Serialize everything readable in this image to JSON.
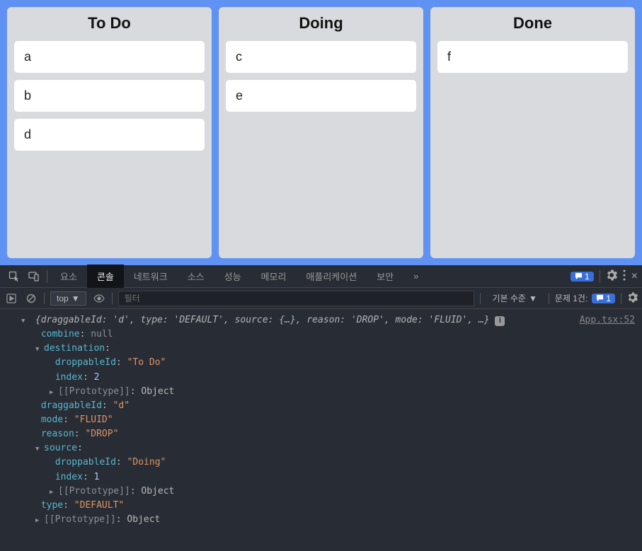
{
  "kanban": {
    "columns": [
      {
        "title": "To Do",
        "cards": [
          "a",
          "b",
          "d"
        ]
      },
      {
        "title": "Doing",
        "cards": [
          "c",
          "e"
        ]
      },
      {
        "title": "Done",
        "cards": [
          "f"
        ]
      }
    ]
  },
  "devtools": {
    "tabs": [
      "요소",
      "콘솔",
      "네트워크",
      "소스",
      "성능",
      "메모리",
      "애플리케이션",
      "보안"
    ],
    "active_tab": "콘솔",
    "more_symbol": "»",
    "badge_count": "1",
    "filter": {
      "top_label": "top",
      "placeholder": "필터",
      "level_label": "기본 수준",
      "issue_label": "문제 1건:",
      "issue_count": "1"
    },
    "console": {
      "source_link": "App.tsx:52",
      "summary_prefix": "{",
      "summary_items": "draggableId: 'd', type: 'DEFAULT', source: {…}, reason: 'DROP', mode: 'FLUID', …}",
      "lines": {
        "combine_key": "combine",
        "combine_val": "null",
        "destination_key": "destination",
        "dest_droppable_key": "droppableId",
        "dest_droppable_val": "\"To Do\"",
        "dest_index_key": "index",
        "dest_index_val": "2",
        "proto_key": "[[Prototype]]",
        "proto_val": "Object",
        "draggable_key": "draggableId",
        "draggable_val": "\"d\"",
        "mode_key": "mode",
        "mode_val": "\"FLUID\"",
        "reason_key": "reason",
        "reason_val": "\"DROP\"",
        "source_key": "source",
        "src_droppable_key": "droppableId",
        "src_droppable_val": "\"Doing\"",
        "src_index_key": "index",
        "src_index_val": "1",
        "type_key": "type",
        "type_val": "\"DEFAULT\""
      }
    }
  }
}
